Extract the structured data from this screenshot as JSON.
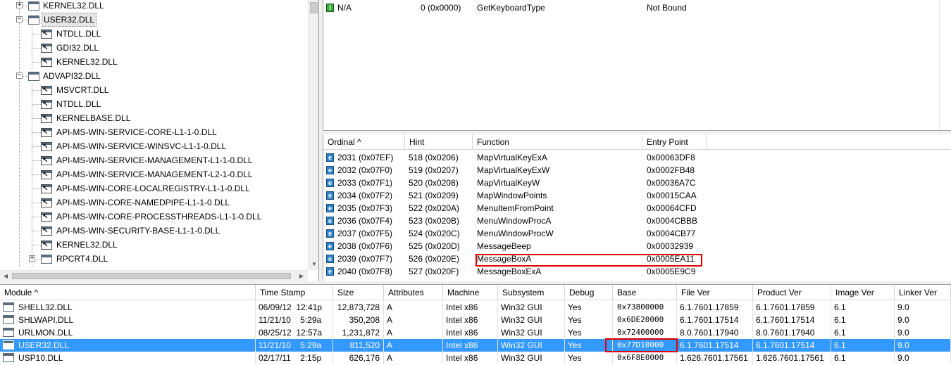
{
  "tree": {
    "nodes": [
      {
        "label": "KERNEL32.DLL",
        "level": 1,
        "expander": "+",
        "kind": "module"
      },
      {
        "label": "USER32.DLL",
        "level": 1,
        "expander": "−",
        "kind": "module",
        "selected": true
      },
      {
        "label": "NTDLL.DLL",
        "level": 2,
        "kind": "forward"
      },
      {
        "label": "GDI32.DLL",
        "level": 2,
        "kind": "forward"
      },
      {
        "label": "KERNEL32.DLL",
        "level": 2,
        "kind": "forward"
      },
      {
        "label": "ADVAPI32.DLL",
        "level": 1,
        "expander": "−",
        "kind": "module"
      },
      {
        "label": "MSVCRT.DLL",
        "level": 2,
        "kind": "forward"
      },
      {
        "label": "NTDLL.DLL",
        "level": 2,
        "kind": "forward"
      },
      {
        "label": "KERNELBASE.DLL",
        "level": 2,
        "kind": "forward"
      },
      {
        "label": "API-MS-WIN-SERVICE-CORE-L1-1-0.DLL",
        "level": 2,
        "kind": "forward"
      },
      {
        "label": "API-MS-WIN-SERVICE-WINSVC-L1-1-0.DLL",
        "level": 2,
        "kind": "forward"
      },
      {
        "label": "API-MS-WIN-SERVICE-MANAGEMENT-L1-1-0.DLL",
        "level": 2,
        "kind": "forward"
      },
      {
        "label": "API-MS-WIN-SERVICE-MANAGEMENT-L2-1-0.DLL",
        "level": 2,
        "kind": "forward"
      },
      {
        "label": "API-MS-WIN-CORE-LOCALREGISTRY-L1-1-0.DLL",
        "level": 2,
        "kind": "forward"
      },
      {
        "label": "API-MS-WIN-CORE-NAMEDPIPE-L1-1-0.DLL",
        "level": 2,
        "kind": "forward"
      },
      {
        "label": "API-MS-WIN-CORE-PROCESSTHREADS-L1-1-0.DLL",
        "level": 2,
        "kind": "forward"
      },
      {
        "label": "API-MS-WIN-SECURITY-BASE-L1-1-0.DLL",
        "level": 2,
        "kind": "forward"
      },
      {
        "label": "KERNEL32.DLL",
        "level": 2,
        "kind": "forward"
      },
      {
        "label": "RPCRT4.DLL",
        "level": 2,
        "expander": "+",
        "kind": "module"
      }
    ]
  },
  "imports": {
    "rows": [
      {
        "icon": "import-function-icon",
        "icon_glyph": "I",
        "ordinal": "N/A",
        "hint": "0  (0x0000)",
        "function": "GetKeyboardType",
        "entry_point": "Not Bound"
      }
    ]
  },
  "exports": {
    "columns": [
      "Ordinal ^",
      "Hint",
      "Function",
      "Entry Point"
    ],
    "rows": [
      {
        "ordinal": "2031  (0x07EF)",
        "hint": "518  (0x0206)",
        "function": "MapVirtualKeyExA",
        "entry_point": "0x00063DF8"
      },
      {
        "ordinal": "2032  (0x07F0)",
        "hint": "519  (0x0207)",
        "function": "MapVirtualKeyExW",
        "entry_point": "0x0002FB48"
      },
      {
        "ordinal": "2033  (0x07F1)",
        "hint": "520  (0x0208)",
        "function": "MapVirtualKeyW",
        "entry_point": "0x00036A7C"
      },
      {
        "ordinal": "2034  (0x07F2)",
        "hint": "521  (0x0209)",
        "function": "MapWindowPoints",
        "entry_point": "0x00015CAA"
      },
      {
        "ordinal": "2035  (0x07F3)",
        "hint": "522  (0x020A)",
        "function": "MenuItemFromPoint",
        "entry_point": "0x00064CFD"
      },
      {
        "ordinal": "2036  (0x07F4)",
        "hint": "523  (0x020B)",
        "function": "MenuWindowProcA",
        "entry_point": "0x0004CBBB"
      },
      {
        "ordinal": "2037  (0x07F5)",
        "hint": "524  (0x020C)",
        "function": "MenuWindowProcW",
        "entry_point": "0x0004CB77"
      },
      {
        "ordinal": "2038  (0x07F6)",
        "hint": "525  (0x020D)",
        "function": "MessageBeep",
        "entry_point": "0x00032939"
      },
      {
        "ordinal": "2039  (0x07F7)",
        "hint": "526  (0x020E)",
        "function": "MessageBoxA",
        "entry_point": "0x0005EA11",
        "highlighted": true
      },
      {
        "ordinal": "2040  (0x07F8)",
        "hint": "527  (0x020F)",
        "function": "MessageBoxExA",
        "entry_point": "0x0005E9C9"
      }
    ],
    "icon_glyph": "e"
  },
  "modules": {
    "columns": [
      "Module ^",
      "Time Stamp",
      "Size",
      "Attributes",
      "Machine",
      "Subsystem",
      "Debug",
      "Base",
      "File Ver",
      "Product Ver",
      "Image Ver",
      "Linker Ver"
    ],
    "rows": [
      {
        "module": "SHELL32.DLL",
        "timestamp": "06/09/12  12:41p",
        "size": "12,873,728",
        "attributes": "A",
        "machine": "Intel x86",
        "subsystem": "Win32 GUI",
        "debug": "Yes",
        "base": "0x73800000",
        "file_ver": "6.1.7601.17859",
        "product_ver": "6.1.7601.17859",
        "image_ver": "6.1",
        "linker_ver": "9.0"
      },
      {
        "module": "SHLWAPI.DLL",
        "timestamp": "11/21/10    5:29a",
        "size": "350,208",
        "attributes": "A",
        "machine": "Intel x86",
        "subsystem": "Win32 GUI",
        "debug": "Yes",
        "base": "0x6DE20000",
        "file_ver": "6.1.7601.17514",
        "product_ver": "6.1.7601.17514",
        "image_ver": "6.1",
        "linker_ver": "9.0"
      },
      {
        "module": "URLMON.DLL",
        "timestamp": "08/25/12  12:57a",
        "size": "1,231,872",
        "attributes": "A",
        "machine": "Intel x86",
        "subsystem": "Win32 GUI",
        "debug": "Yes",
        "base": "0x72400000",
        "file_ver": "8.0.7601.17940",
        "product_ver": "8.0.7601.17940",
        "image_ver": "6.1",
        "linker_ver": "9.0"
      },
      {
        "module": "USER32.DLL",
        "timestamp": "11/21/10    5:29a",
        "size": "811,520",
        "attributes": "A",
        "machine": "Intel x86",
        "subsystem": "Win32 GUI",
        "debug": "Yes",
        "base": "0x77D10000",
        "file_ver": "6.1.7601.17514",
        "product_ver": "6.1.7601.17514",
        "image_ver": "6.1",
        "linker_ver": "9.0",
        "selected": true
      },
      {
        "module": "USP10.DLL",
        "timestamp": "02/17/11    2:15p",
        "size": "626,176",
        "attributes": "A",
        "machine": "Intel x86",
        "subsystem": "Win32 GUI",
        "debug": "Yes",
        "base": "0x6F8E0000",
        "file_ver": "1.626.7601.17561",
        "product_ver": "1.626.7601.17561",
        "image_ver": "6.1",
        "linker_ver": "9.0"
      }
    ]
  },
  "colors": {
    "selection": "#3399ff",
    "highlight_box": "#e00000",
    "import_icon": "#39a839",
    "export_icon": "#2f86cc"
  }
}
